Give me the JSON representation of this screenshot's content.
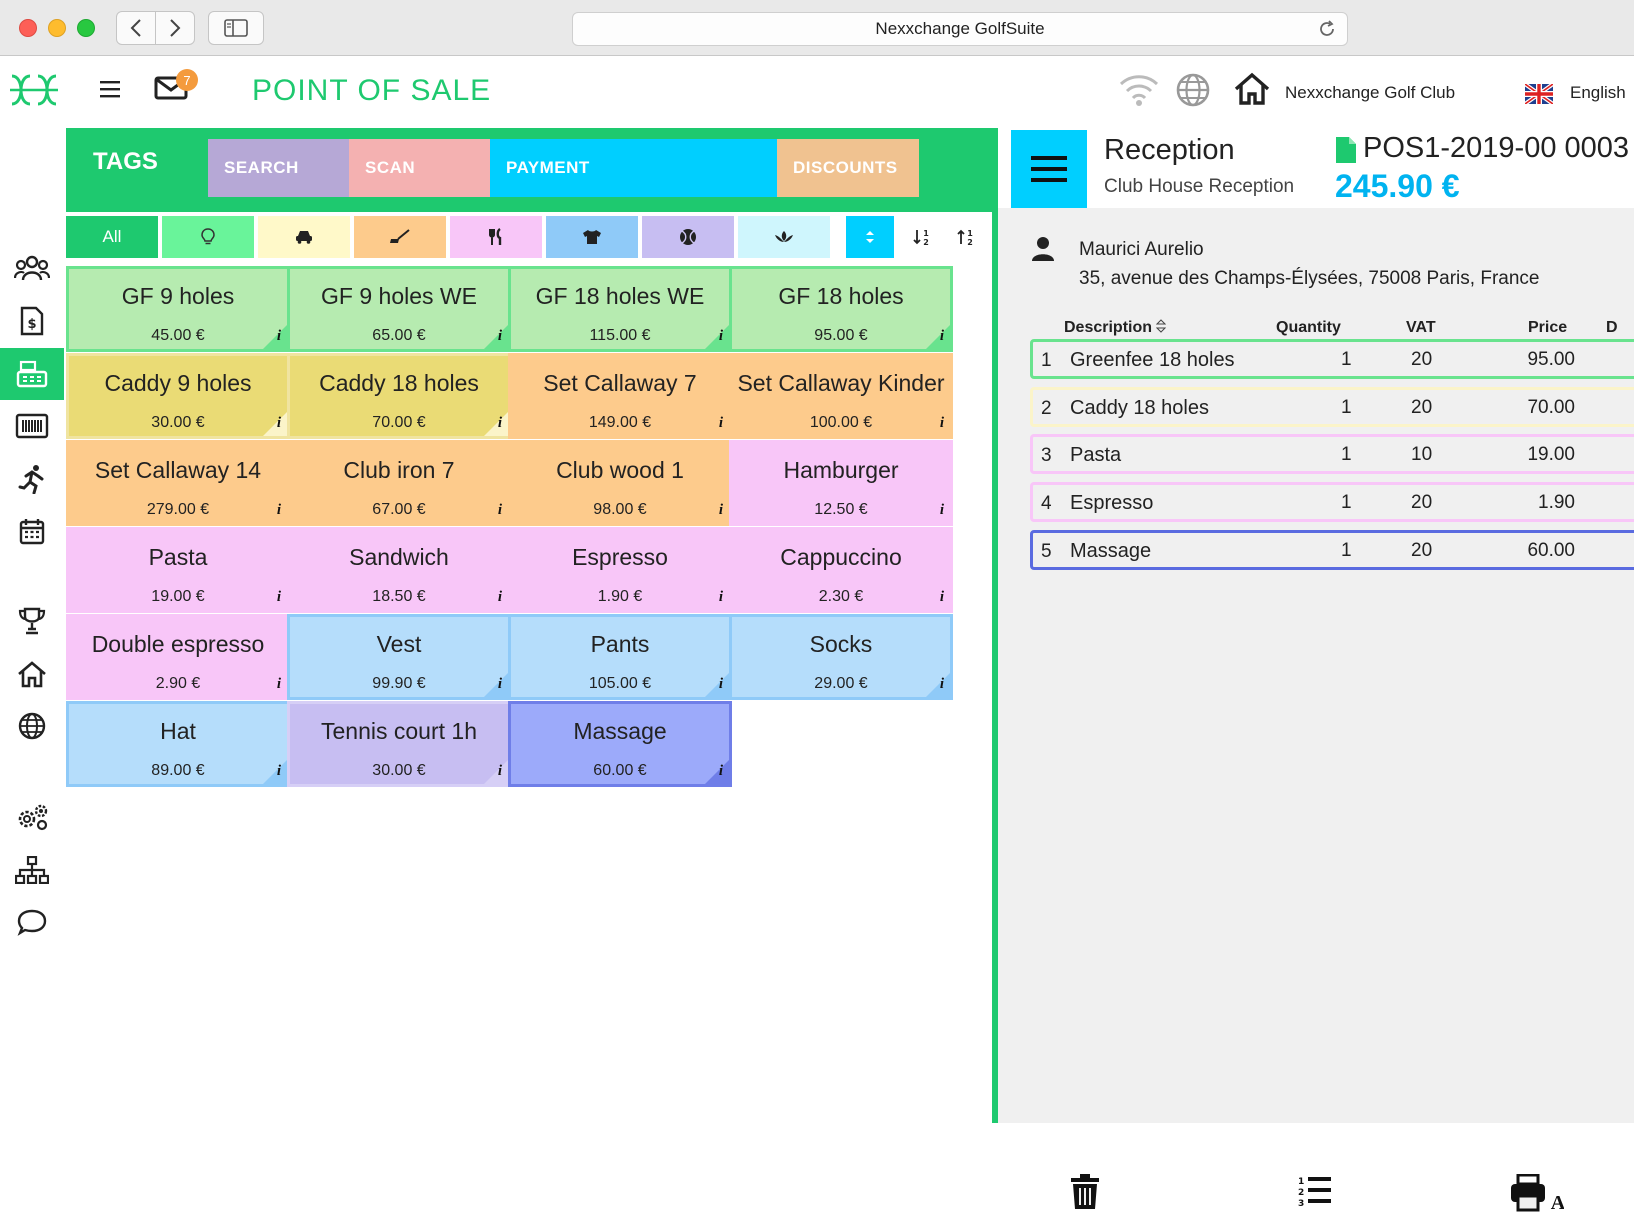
{
  "browser": {
    "url_title": "Nexxchange GolfSuite"
  },
  "header": {
    "title": "POINT OF SALE",
    "mail_badge": "7",
    "club_name": "Nexxchange Golf Club",
    "language": "English"
  },
  "tabs": {
    "tags": "TAGS",
    "search": "SEARCH",
    "scan": "SCAN",
    "payment": "PAYMENT",
    "discounts": "DISCOUNTS"
  },
  "filters": {
    "all": "All",
    "icons": [
      "lightbulb-icon",
      "car-icon",
      "golf-club-icon",
      "fork-knife-icon",
      "shirt-icon",
      "tennis-ball-icon",
      "lotus-icon"
    ],
    "colors": [
      "#69f49a",
      "#fff9c9",
      "#fdcb8c",
      "#f8c6f8",
      "#8fcaf8",
      "#c7bef2",
      "#cff6fd"
    ]
  },
  "products": [
    {
      "name": "GF 9 holes",
      "price": "45.00 €",
      "color": "green"
    },
    {
      "name": "GF 9 holes WE",
      "price": "65.00 €",
      "color": "green"
    },
    {
      "name": "GF 18 holes WE",
      "price": "115.00 €",
      "color": "green"
    },
    {
      "name": "GF 18 holes",
      "price": "95.00 €",
      "color": "green"
    },
    {
      "name": "Caddy 9 holes",
      "price": "30.00 €",
      "color": "yellow"
    },
    {
      "name": "Caddy 18 holes",
      "price": "70.00 €",
      "color": "yellow"
    },
    {
      "name": "Set Callaway 7",
      "price": "149.00 €",
      "color": "orange"
    },
    {
      "name": "Set Callaway Kinder",
      "price": "100.00 €",
      "color": "orange"
    },
    {
      "name": "Set Callaway 14",
      "price": "279.00 €",
      "color": "orange"
    },
    {
      "name": "Club iron 7",
      "price": "67.00 €",
      "color": "orange"
    },
    {
      "name": "Club wood 1",
      "price": "98.00 €",
      "color": "orange"
    },
    {
      "name": "Hamburger",
      "price": "12.50 €",
      "color": "pink"
    },
    {
      "name": "Pasta",
      "price": "19.00 €",
      "color": "pink"
    },
    {
      "name": "Sandwich",
      "price": "18.50 €",
      "color": "pink"
    },
    {
      "name": "Espresso",
      "price": "1.90 €",
      "color": "pink"
    },
    {
      "name": "Cappuccino",
      "price": "2.30 €",
      "color": "pink"
    },
    {
      "name": "Double espresso",
      "price": "2.90 €",
      "color": "pink"
    },
    {
      "name": "Vest",
      "price": "99.90 €",
      "color": "blue"
    },
    {
      "name": "Pants",
      "price": "105.00 €",
      "color": "blue"
    },
    {
      "name": "Socks",
      "price": "29.00 €",
      "color": "blue"
    },
    {
      "name": "Hat",
      "price": "89.00 €",
      "color": "blue"
    },
    {
      "name": "Tennis court 1h",
      "price": "30.00 €",
      "color": "lav"
    },
    {
      "name": "Massage",
      "price": "60.00 €",
      "color": "indigo"
    }
  ],
  "info_glyph": "i",
  "receipt": {
    "title": "Reception",
    "subtitle": "Club House Reception",
    "doc_number": "POS1-2019-00 0003",
    "total": "245.90 €",
    "customer_name": "Maurici Aurelio",
    "customer_address": "35, avenue des Champs-Élysées, 75008 Paris, France",
    "columns": {
      "description": "Description",
      "quantity": "Quantity",
      "vat": "VAT",
      "price": "Price",
      "extra": "D"
    },
    "lines": [
      {
        "n": "1",
        "description": "Greenfee 18 holes",
        "quantity": "1",
        "vat": "20",
        "price": "95.00",
        "border": "#69e38e"
      },
      {
        "n": "2",
        "description": "Caddy 18 holes",
        "quantity": "1",
        "vat": "20",
        "price": "70.00",
        "border": "#fbf4c9"
      },
      {
        "n": "3",
        "description": "Pasta",
        "quantity": "1",
        "vat": "10",
        "price": "19.00",
        "border": "#f8c6f8"
      },
      {
        "n": "4",
        "description": "Espresso",
        "quantity": "1",
        "vat": "20",
        "price": "1.90",
        "border": "#f8c6f8"
      },
      {
        "n": "5",
        "description": "Massage",
        "quantity": "1",
        "vat": "20",
        "price": "60.00",
        "border": "#5a6be0"
      }
    ]
  },
  "colors": {
    "brand_green": "#1ec96f",
    "accent_cyan": "#00cfff",
    "total_blue": "#00b3f0"
  }
}
